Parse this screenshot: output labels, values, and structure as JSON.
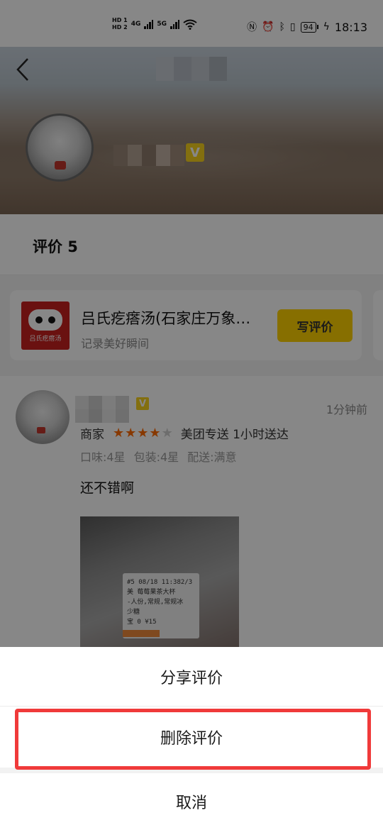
{
  "status_bar": {
    "hd1": "HD 1",
    "hd2": "HD 2",
    "net1": "4G",
    "net2": "5G",
    "battery": "94",
    "time": "18:13"
  },
  "profile": {
    "back_icon": "chevron-left-icon",
    "verified_badge": "V"
  },
  "tabs": {
    "reviews_label": "评价 5"
  },
  "shop_card": {
    "name": "吕氏疙瘩汤(石家庄万象…",
    "subtitle": "记录美好瞬间",
    "write_button": "写评价"
  },
  "review": {
    "time": "1分钟前",
    "merchant_label": "商家",
    "rating": 4,
    "max_rating": 5,
    "delivery": "美团专送 1小时送达",
    "taste": "口味:4星",
    "packaging": "包装:4星",
    "delivery_rating": "配送:满意",
    "text": "还不错啊",
    "photo_label_lines": [
      "#5  08/18 11:382/3",
      "美 莓莓果茶大杯",
      "-人份,常规,常规冰",
      "少糖",
      "宝 0       ¥15"
    ]
  },
  "action_sheet": {
    "share": "分享评价",
    "delete": "删除评价",
    "cancel": "取消"
  },
  "colors": {
    "accent_yellow": "#FFD100",
    "star_orange": "#FF6A00",
    "highlight_red": "#F03A3A",
    "scrim": "rgba(0,0,0,0.47)"
  }
}
